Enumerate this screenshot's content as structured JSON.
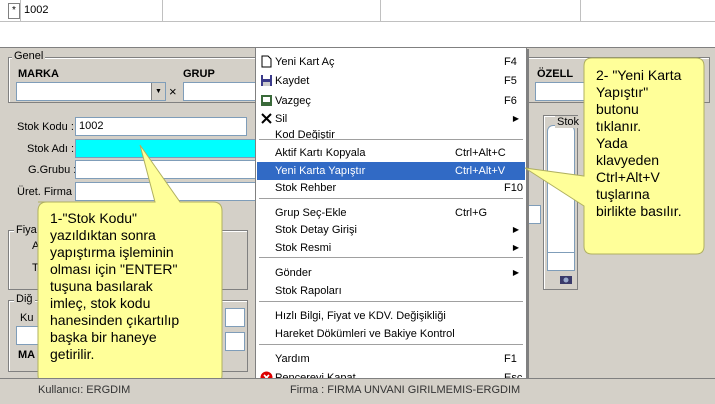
{
  "grid": {
    "row_marker": "*",
    "first_value": "1002"
  },
  "general": {
    "title": "Genel",
    "marka_label": "MARKA",
    "grup_label": "GRUP",
    "ozell_label": "ÖZELL",
    "clear_glyph": "×",
    "stok_kodu_label": "Stok Kodu :",
    "stok_kodu_value": "1002",
    "stok_adi_label": "Stok Adı :",
    "ggrubu_label": "G.Grubu :",
    "uret_firma_label": "Üret. Firma :",
    "fiy_label": "Fiya",
    "dig_label": "Diğ",
    "ku_label": "Ku",
    "ma_label": "MA",
    "a_label": "A",
    "t_label": "T",
    "stok_panel_label": "Stok"
  },
  "menu": {
    "items": [
      {
        "label": "Yeni Kart Aç",
        "shortcut": "F4",
        "icon": "new-doc-icon"
      },
      {
        "label": "Kaydet",
        "shortcut": "F5",
        "icon": "save-icon"
      },
      {
        "label": "Vazgeç",
        "shortcut": "F6",
        "icon": "undo-icon"
      },
      {
        "label": "Sil",
        "shortcut": "",
        "icon": "delete-icon",
        "submenu": true
      },
      {
        "label": "Kod Değiştir",
        "shortcut": ""
      },
      {
        "label": "Aktif Kartı Kopyala",
        "shortcut": "Ctrl+Alt+C"
      },
      {
        "label": "Yeni Karta Yapıştır",
        "shortcut": "Ctrl+Alt+V",
        "highlighted": true
      },
      {
        "label": "Stok Rehber",
        "shortcut": "F10"
      },
      {
        "label": "Grup Seç-Ekle",
        "shortcut": "Ctrl+G"
      },
      {
        "label": "Stok Detay Girişi",
        "shortcut": "",
        "submenu": true
      },
      {
        "label": "Stok Resmi",
        "shortcut": "",
        "submenu": true
      },
      {
        "label": "Gönder",
        "shortcut": "",
        "submenu": true
      },
      {
        "label": "Stok Rapoları",
        "shortcut": ""
      },
      {
        "label": "Hızlı Bilgi, Fiyat ve KDV. Değişikliği",
        "shortcut": ""
      },
      {
        "label": "Hareket Dökümleri ve Bakiye Kontrol",
        "shortcut": ""
      },
      {
        "label": "Yardım",
        "shortcut": "F1"
      },
      {
        "label": "Pencereyi Kapat",
        "shortcut": "Esc",
        "icon": "close-red-icon"
      }
    ],
    "submenu_arrow": "▶"
  },
  "callout_left": {
    "lines": [
      "1-\"Stok Kodu\"",
      "yazıldıktan sonra",
      "yapıştırma işleminin",
      "olması için \"ENTER\"",
      "tuşuna basılarak",
      "imleç, stok kodu",
      "hanesinden çıkartılıp",
      "başka bir haneye",
      "getirilir."
    ]
  },
  "callout_right": {
    "lines": [
      "2- \"Yeni Karta",
      "Yapıştır\"",
      "butonu",
      "tıklanır.",
      "Yada",
      "klavyeden",
      "Ctrl+Alt+V",
      "tuşlarına",
      "birlikte basılır."
    ]
  },
  "status": {
    "user": "Kullanıcı: ERGDIM",
    "company": "Firma : FIRMA UNVANI GIRILMEMIS-ERGDIM"
  }
}
